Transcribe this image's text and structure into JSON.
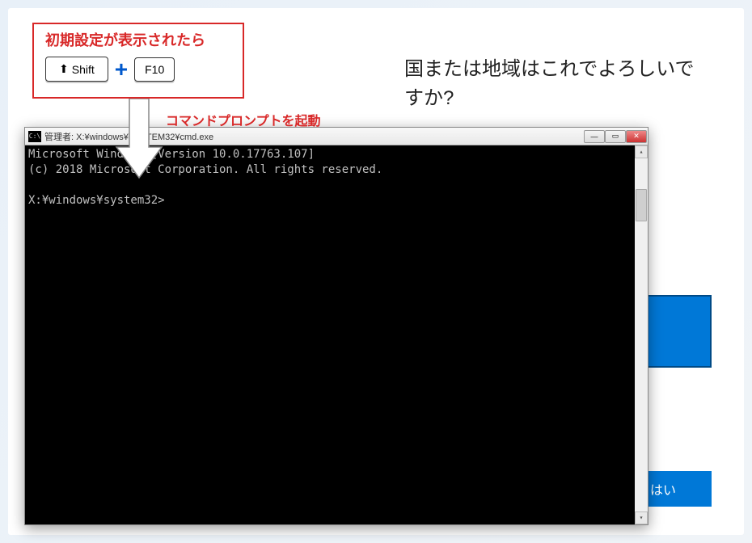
{
  "annotation": {
    "title": "初期設定が表示されたら",
    "key1": "Shift",
    "plus": "+",
    "key2": "F10",
    "subtitle": "コマンドプロンプトを起動"
  },
  "oobe": {
    "title": "国または地域はこれでよろしいですか?",
    "yes_label": "はい"
  },
  "cmd": {
    "icon_text": "C:\\",
    "title": "管理者: X:¥windows¥SYSTEM32¥cmd.exe",
    "line1": "Microsoft Windows [Version 10.0.17763.107]",
    "line2": "(c) 2018 Microsoft Corporation. All rights reserved.",
    "prompt": "X:¥windows¥system32>",
    "min": "—",
    "max": "▭",
    "close": "✕",
    "sb_up": "▴",
    "sb_down": "▾"
  }
}
